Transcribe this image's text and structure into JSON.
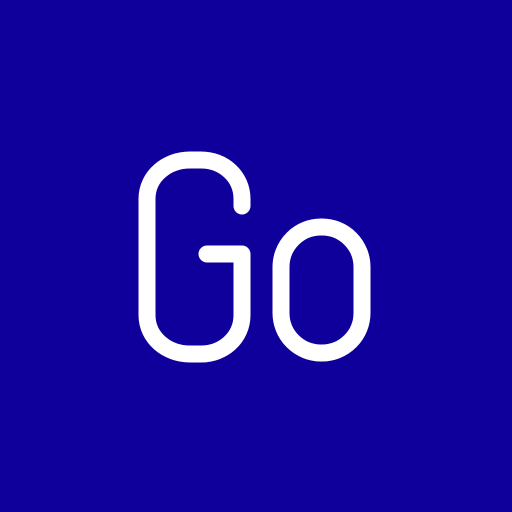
{
  "tile": {
    "text": "Go",
    "background_color": "#10009b",
    "text_color": "#ffffff"
  }
}
